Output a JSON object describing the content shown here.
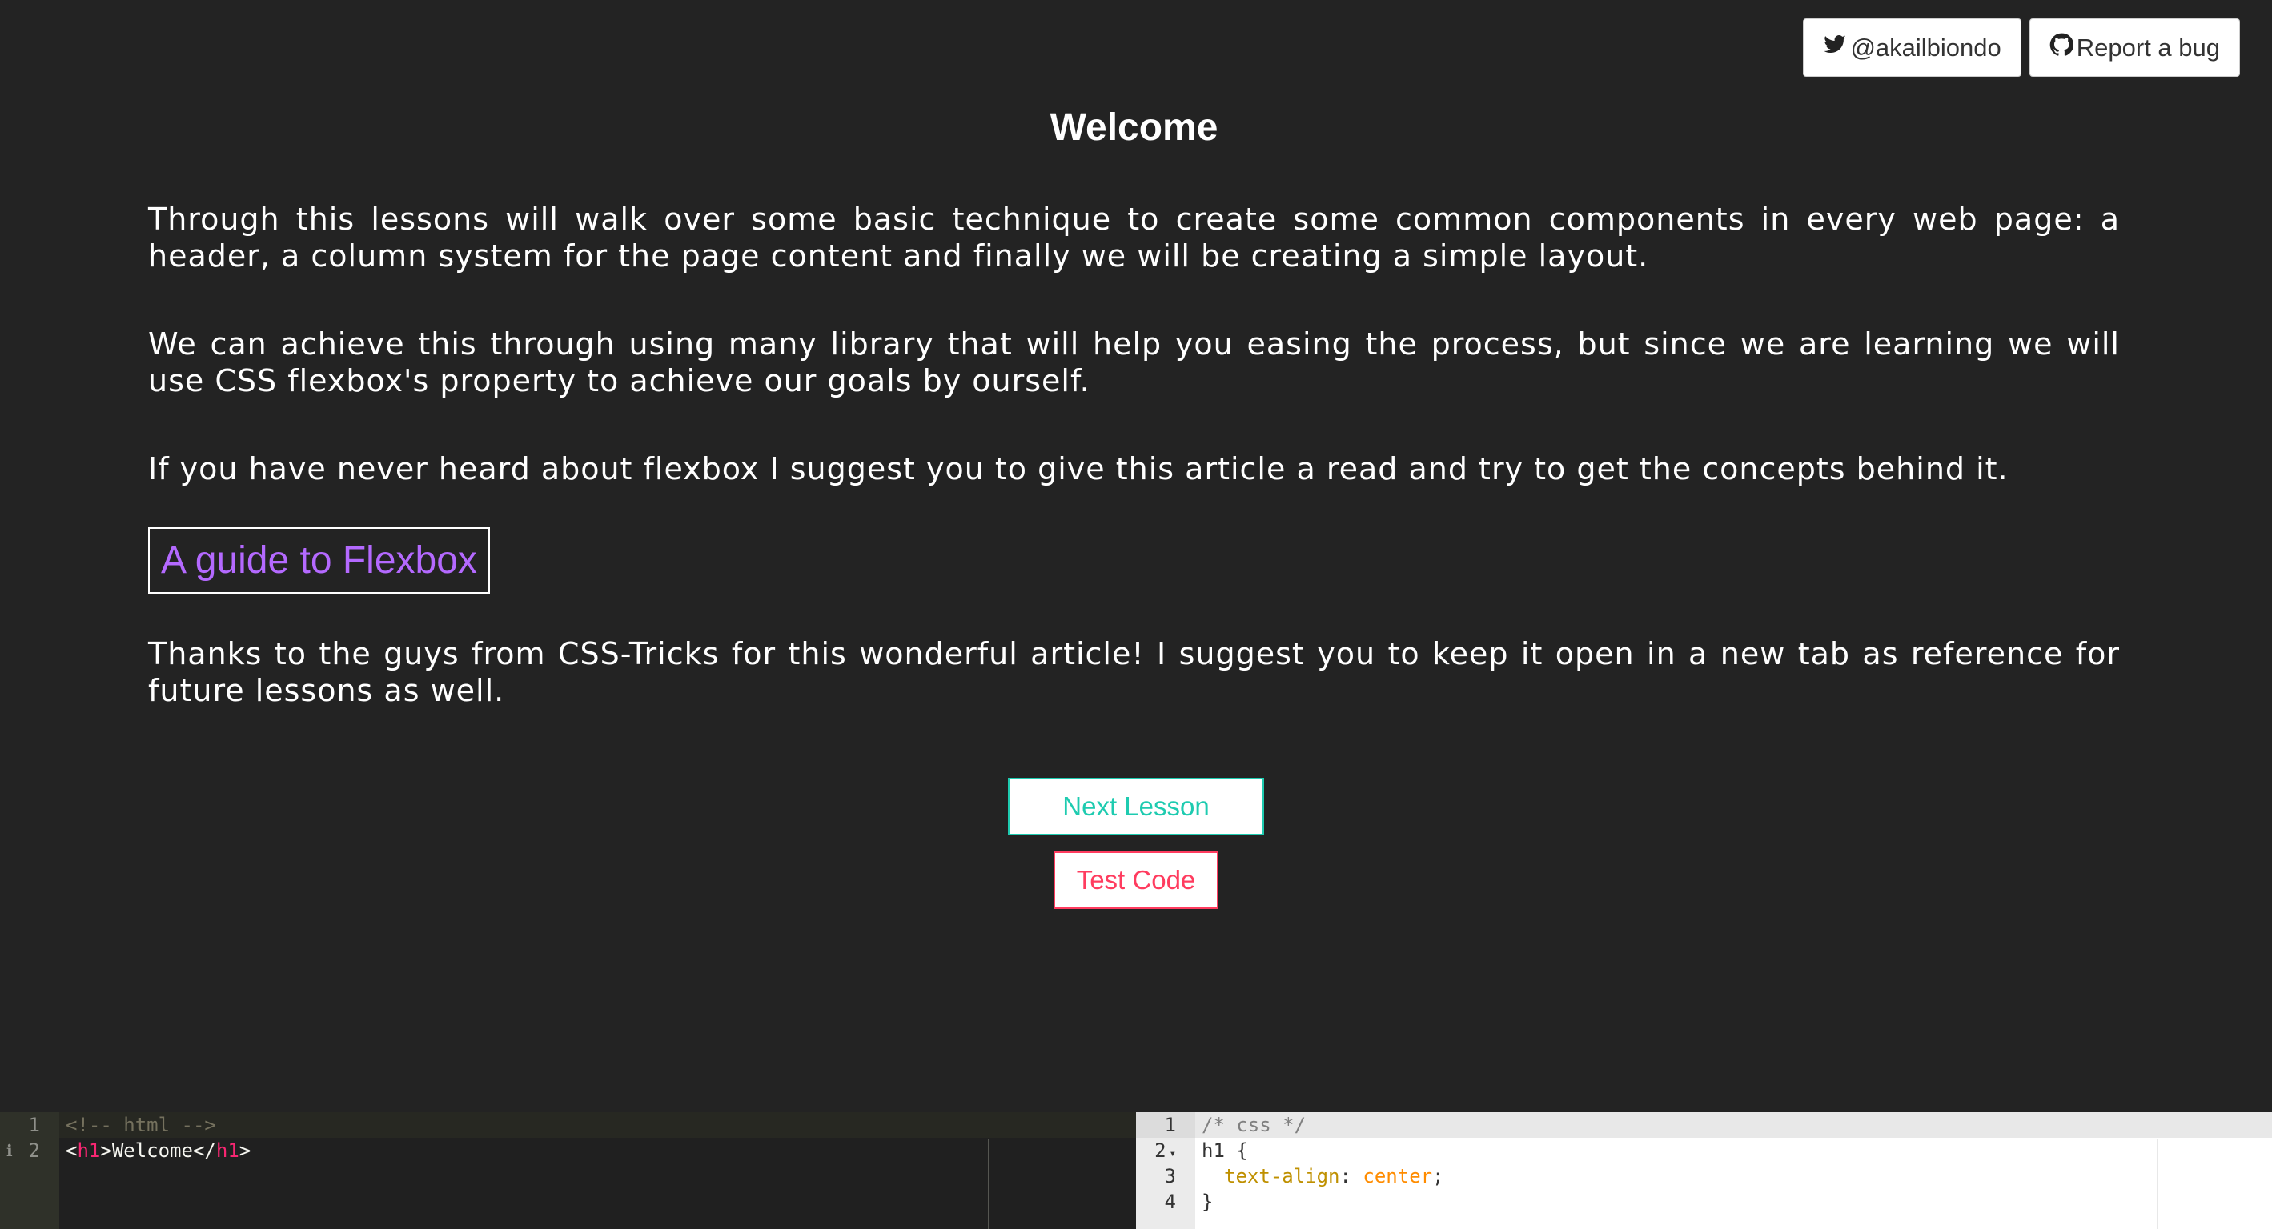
{
  "header": {
    "twitter_label": "@akailbiondo",
    "bug_label": "Report a bug"
  },
  "lesson": {
    "title": "Welcome",
    "p1": "Through this lessons will walk over some basic technique to create some common components in every web page: a header, a column system for the page content and finally we will be creating a simple layout.",
    "p2": "We can achieve this through using many library that will help you easing the process, but since we are learning we will use CSS flexbox's property to achieve our goals by ourself.",
    "p3": "If you have never heard about flexbox I suggest you to give this article a read and try to get the concepts behind it.",
    "link_label": "A guide to Flexbox",
    "p4": "Thanks to the guys from CSS-Tricks for this wonderful article! I suggest you to keep it open in a new tab as reference for future lessons as well."
  },
  "actions": {
    "next_label": "Next Lesson",
    "test_label": "Test Code"
  },
  "html_editor": {
    "line_numbers": [
      "1",
      "2"
    ],
    "line1": "<!-- html -->",
    "line2_open_lt": "<",
    "line2_tag": "h1",
    "line2_gt": ">",
    "line2_text": "Welcome",
    "line2_close_lt": "</",
    "line2_close_tag": "h1",
    "line2_close_gt": ">"
  },
  "css_editor": {
    "line_numbers": [
      "1",
      "2",
      "3",
      "4"
    ],
    "line1": "/* css */",
    "line2": "h1 {",
    "line3_prop": "text-align",
    "line3_colon": ": ",
    "line3_value": "center",
    "line3_semi": ";",
    "line4": "}"
  },
  "colors": {
    "background": "#232323",
    "link": "#b469ff",
    "next_accent": "#1ecbb0",
    "test_accent": "#ff3c5f"
  },
  "icons": {
    "twitter": "twitter-icon",
    "github": "github-icon"
  }
}
